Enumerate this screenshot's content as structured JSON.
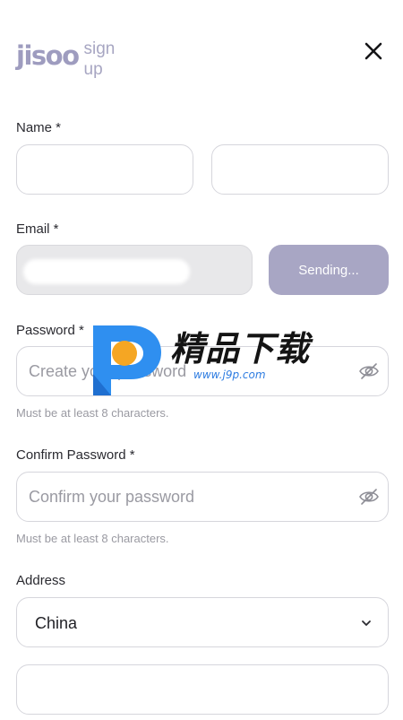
{
  "header": {
    "logo_text": "jisoo",
    "logo_subtitle": "sign up",
    "close_icon": "close-icon"
  },
  "form": {
    "name": {
      "label": "Name *",
      "first_value": "",
      "last_value": ""
    },
    "email": {
      "label": "Email *",
      "value": "",
      "send_button_label": "Sending..."
    },
    "password": {
      "label": "Password *",
      "placeholder": "Create your password",
      "hint": "Must be at least 8 characters.",
      "toggle_icon": "eye-off-icon"
    },
    "confirm_password": {
      "label": "Confirm Password *",
      "placeholder": "Confirm your password",
      "hint": "Must be at least 8 characters.",
      "toggle_icon": "eye-off-icon"
    },
    "address": {
      "label": "Address",
      "country_selected": "China",
      "detail_value": ""
    }
  },
  "watermark": {
    "text": "精品下载",
    "url": "www.j9p.com"
  },
  "colors": {
    "accent": "#a8a6c4",
    "logo": "#9e9cbf",
    "border": "#d6d6dc",
    "hint": "#9a9aa2"
  }
}
